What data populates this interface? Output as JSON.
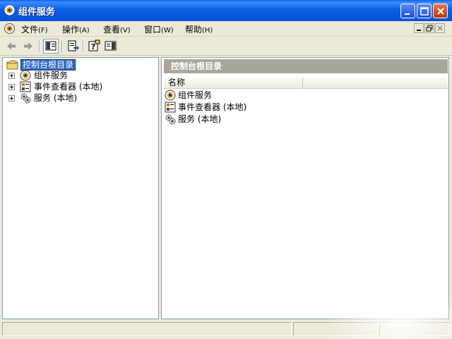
{
  "window": {
    "title": "组件服务",
    "icon": "component-services-icon"
  },
  "menu": [
    {
      "label": "文件",
      "key": "(F)"
    },
    {
      "label": "操作",
      "key": "(A)"
    },
    {
      "label": "查看",
      "key": "(V)"
    },
    {
      "label": "窗口",
      "key": "(W)"
    },
    {
      "label": "帮助",
      "key": "(H)"
    }
  ],
  "tree": {
    "root": "控制台根目录",
    "items": [
      "组件服务",
      "事件查看器 (本地)",
      "服务 (本地)"
    ]
  },
  "right_pane": {
    "header": "控制台根目录",
    "column": "名称",
    "items": [
      "组件服务",
      "事件查看器 (本地)",
      "服务 (本地)"
    ]
  },
  "colors": {
    "title_bar": "#0b5ee4",
    "accent_selected": "#316ac5",
    "pane_header": "#a9a698"
  }
}
